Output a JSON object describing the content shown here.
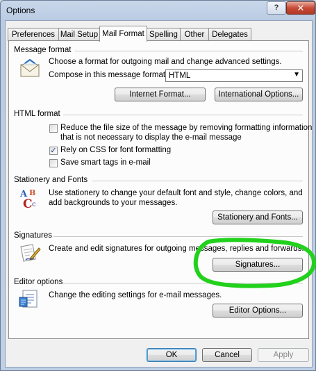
{
  "window": {
    "title": "Options",
    "help_glyph": "?",
    "close_glyph": "✕"
  },
  "tabs": [
    {
      "label": "Preferences",
      "active": false
    },
    {
      "label": "Mail Setup",
      "active": false
    },
    {
      "label": "Mail Format",
      "active": true
    },
    {
      "label": "Spelling",
      "active": false
    },
    {
      "label": "Other",
      "active": false
    },
    {
      "label": "Delegates",
      "active": false
    }
  ],
  "message_format": {
    "title": "Message format",
    "description": "Choose a format for outgoing mail and change advanced settings.",
    "compose_label": "Compose in this message format:",
    "compose_value": "HTML",
    "internet_format_button": "Internet Format...",
    "international_options_button": "International Options..."
  },
  "html_format": {
    "title": "HTML format",
    "reduce_line1": "Reduce the file size of the message by removing formatting information",
    "reduce_line2": "that is not necessary to display the e-mail message",
    "reduce_checked": false,
    "css_label": "Rely on CSS for font formatting",
    "css_checked": true,
    "smart_tags_label": "Save smart tags in e-mail",
    "smart_tags_checked": false,
    "check_mark": "✓"
  },
  "stationery": {
    "title": "Stationery and Fonts",
    "line1": "Use stationery to change your default font and style, change colors, and",
    "line2": "add backgrounds to your messages.",
    "button": "Stationery and Fonts..."
  },
  "signatures": {
    "title": "Signatures",
    "description": "Create and edit signatures for outgoing messages, replies and forwards.",
    "button": "Signatures..."
  },
  "editor": {
    "title": "Editor options",
    "description": "Change the editing settings for e-mail messages.",
    "button": "Editor Options..."
  },
  "footer": {
    "ok": "OK",
    "cancel": "Cancel",
    "apply": "Apply"
  },
  "colors": {
    "annotation": "#22d11c"
  }
}
